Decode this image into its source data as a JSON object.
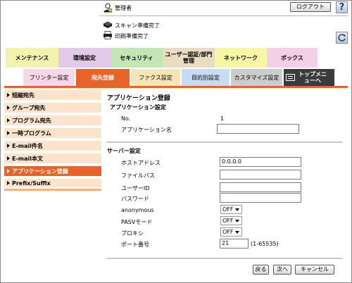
{
  "header": {
    "user_label": "管理者",
    "logout_label": "ログアウト",
    "help_label": "?",
    "scan_status": "スキャン準備完了",
    "print_status": "印刷準備完了"
  },
  "main_tabs": [
    {
      "label": "メンテナンス",
      "color": "#f3f3b0"
    },
    {
      "label": "環境設定",
      "color": "#e2c9ea"
    },
    {
      "label": "セキュリティ",
      "color": "#c2e6b4"
    },
    {
      "label": "ユーザー認証/部門管理",
      "color": "#e9dcc0"
    },
    {
      "label": "ネットワーク",
      "color": "#f7f6a6"
    },
    {
      "label": "ボックス",
      "color": "#f4cfe7"
    }
  ],
  "sub_tabs": [
    {
      "label": "プリンター設定",
      "color": "#f7d7e8"
    },
    {
      "label": "宛先登録",
      "color": "#e8632a",
      "active": true
    },
    {
      "label": "ファクス設定",
      "color": "#f6e6b6"
    },
    {
      "label": "目的別設定",
      "color": "#c7dcf2"
    },
    {
      "label": "カスタマイズ設定",
      "color": "#cccccc"
    },
    {
      "label": "トップメニューへ",
      "color": "#3b3b3b"
    }
  ],
  "sidebar": {
    "items": [
      {
        "label": "短縮宛先",
        "active": false
      },
      {
        "label": "グループ宛先",
        "active": false
      },
      {
        "label": "プログラム宛先",
        "active": false
      },
      {
        "label": "一時プログラム",
        "active": false
      },
      {
        "label": "E-mail件名",
        "active": false
      },
      {
        "label": "E-mail本文",
        "active": false
      },
      {
        "label": "アプリケーション登録",
        "active": true
      },
      {
        "label": "Prefix/Suffix",
        "active": false
      }
    ]
  },
  "content": {
    "page_title": "アプリケーション登録",
    "app_section_title": "アプリケーション設定",
    "no_label": "No.",
    "no_value": "1",
    "app_name_label": "アプリケーション名",
    "app_name_value": "",
    "server_section_title": "サーバー設定",
    "fields": {
      "host_label": "ホストアドレス",
      "host_value": "0.0.0.0",
      "path_label": "ファイルパス",
      "path_value": "",
      "user_label": "ユーザーID",
      "user_value": "",
      "password_label": "パスワード",
      "password_value": "",
      "anonymous_label": "anonymous",
      "anonymous_value": "OFF",
      "pasv_label": "PASVモード",
      "pasv_value": "OFF",
      "proxy_label": "プロキシ",
      "proxy_value": "OFF",
      "port_label": "ポート番号",
      "port_value": "21",
      "port_range": "(1-65535)"
    }
  },
  "footer": {
    "back_label": "戻る",
    "next_label": "次へ",
    "cancel_label": "キャンセル"
  },
  "colors": {
    "accent": "#e8632a",
    "sidebar_bg": "#fbe3cc"
  }
}
